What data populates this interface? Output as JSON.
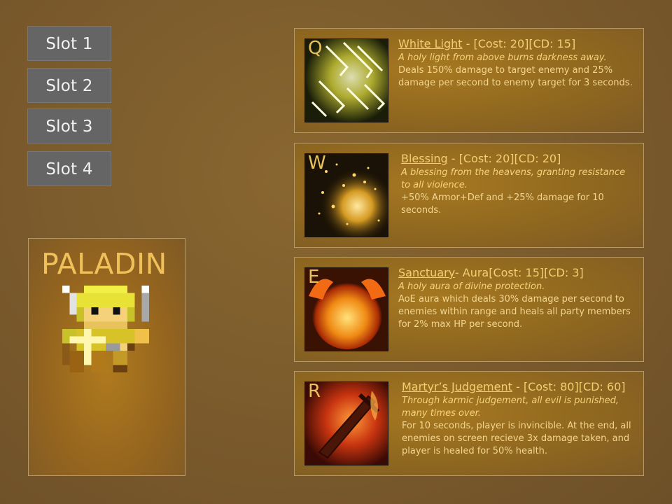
{
  "slots": [
    "Slot 1",
    "Slot 2",
    "Slot 3",
    "Slot 4"
  ],
  "class_panel": {
    "name": "PALADIN"
  },
  "abilities": [
    {
      "hotkey": "Q",
      "name": "White Light",
      "sep": " -  ",
      "stats": "[Cost: 20][CD: 15]",
      "flavor": "A holy light from above burns darkness away.",
      "desc": "Deals 150% damage to target enemy and 25% damage per second to enemy target for 3 seconds.",
      "icon": "holy-light-icon"
    },
    {
      "hotkey": "W",
      "name": "Blessing",
      "sep": " - ",
      "stats": "[Cost: 20][CD: 20]",
      "flavor": "A blessing from the heavens, granting resistance to all violence.",
      "desc": "+50% Armor+Def and +25% damage for 10 seconds.",
      "icon": "blessing-sparkle-icon"
    },
    {
      "hotkey": "E",
      "name": "Sanctuary",
      "sep": "- ",
      "stats": "Aura[Cost: 15][CD: 3]",
      "flavor": "A holy aura of divine protection.",
      "desc": "AoE aura which deals 30% damage per second to enemies within range and heals all party members for 2% max HP per second.",
      "icon": "fire-sphere-icon"
    },
    {
      "hotkey": "R",
      "name": "Martyr’s Judgement",
      "sep": " - ",
      "stats": "[Cost: 80][CD: 60]",
      "flavor": "Through karmic judgement, all evil is punished, many times over.",
      "desc": "For 10 seconds, player is invincible. At the end, all enemies on screen recieve 3x damage taken, and player is healed for 50% health.",
      "icon": "flaming-sword-icon"
    }
  ]
}
